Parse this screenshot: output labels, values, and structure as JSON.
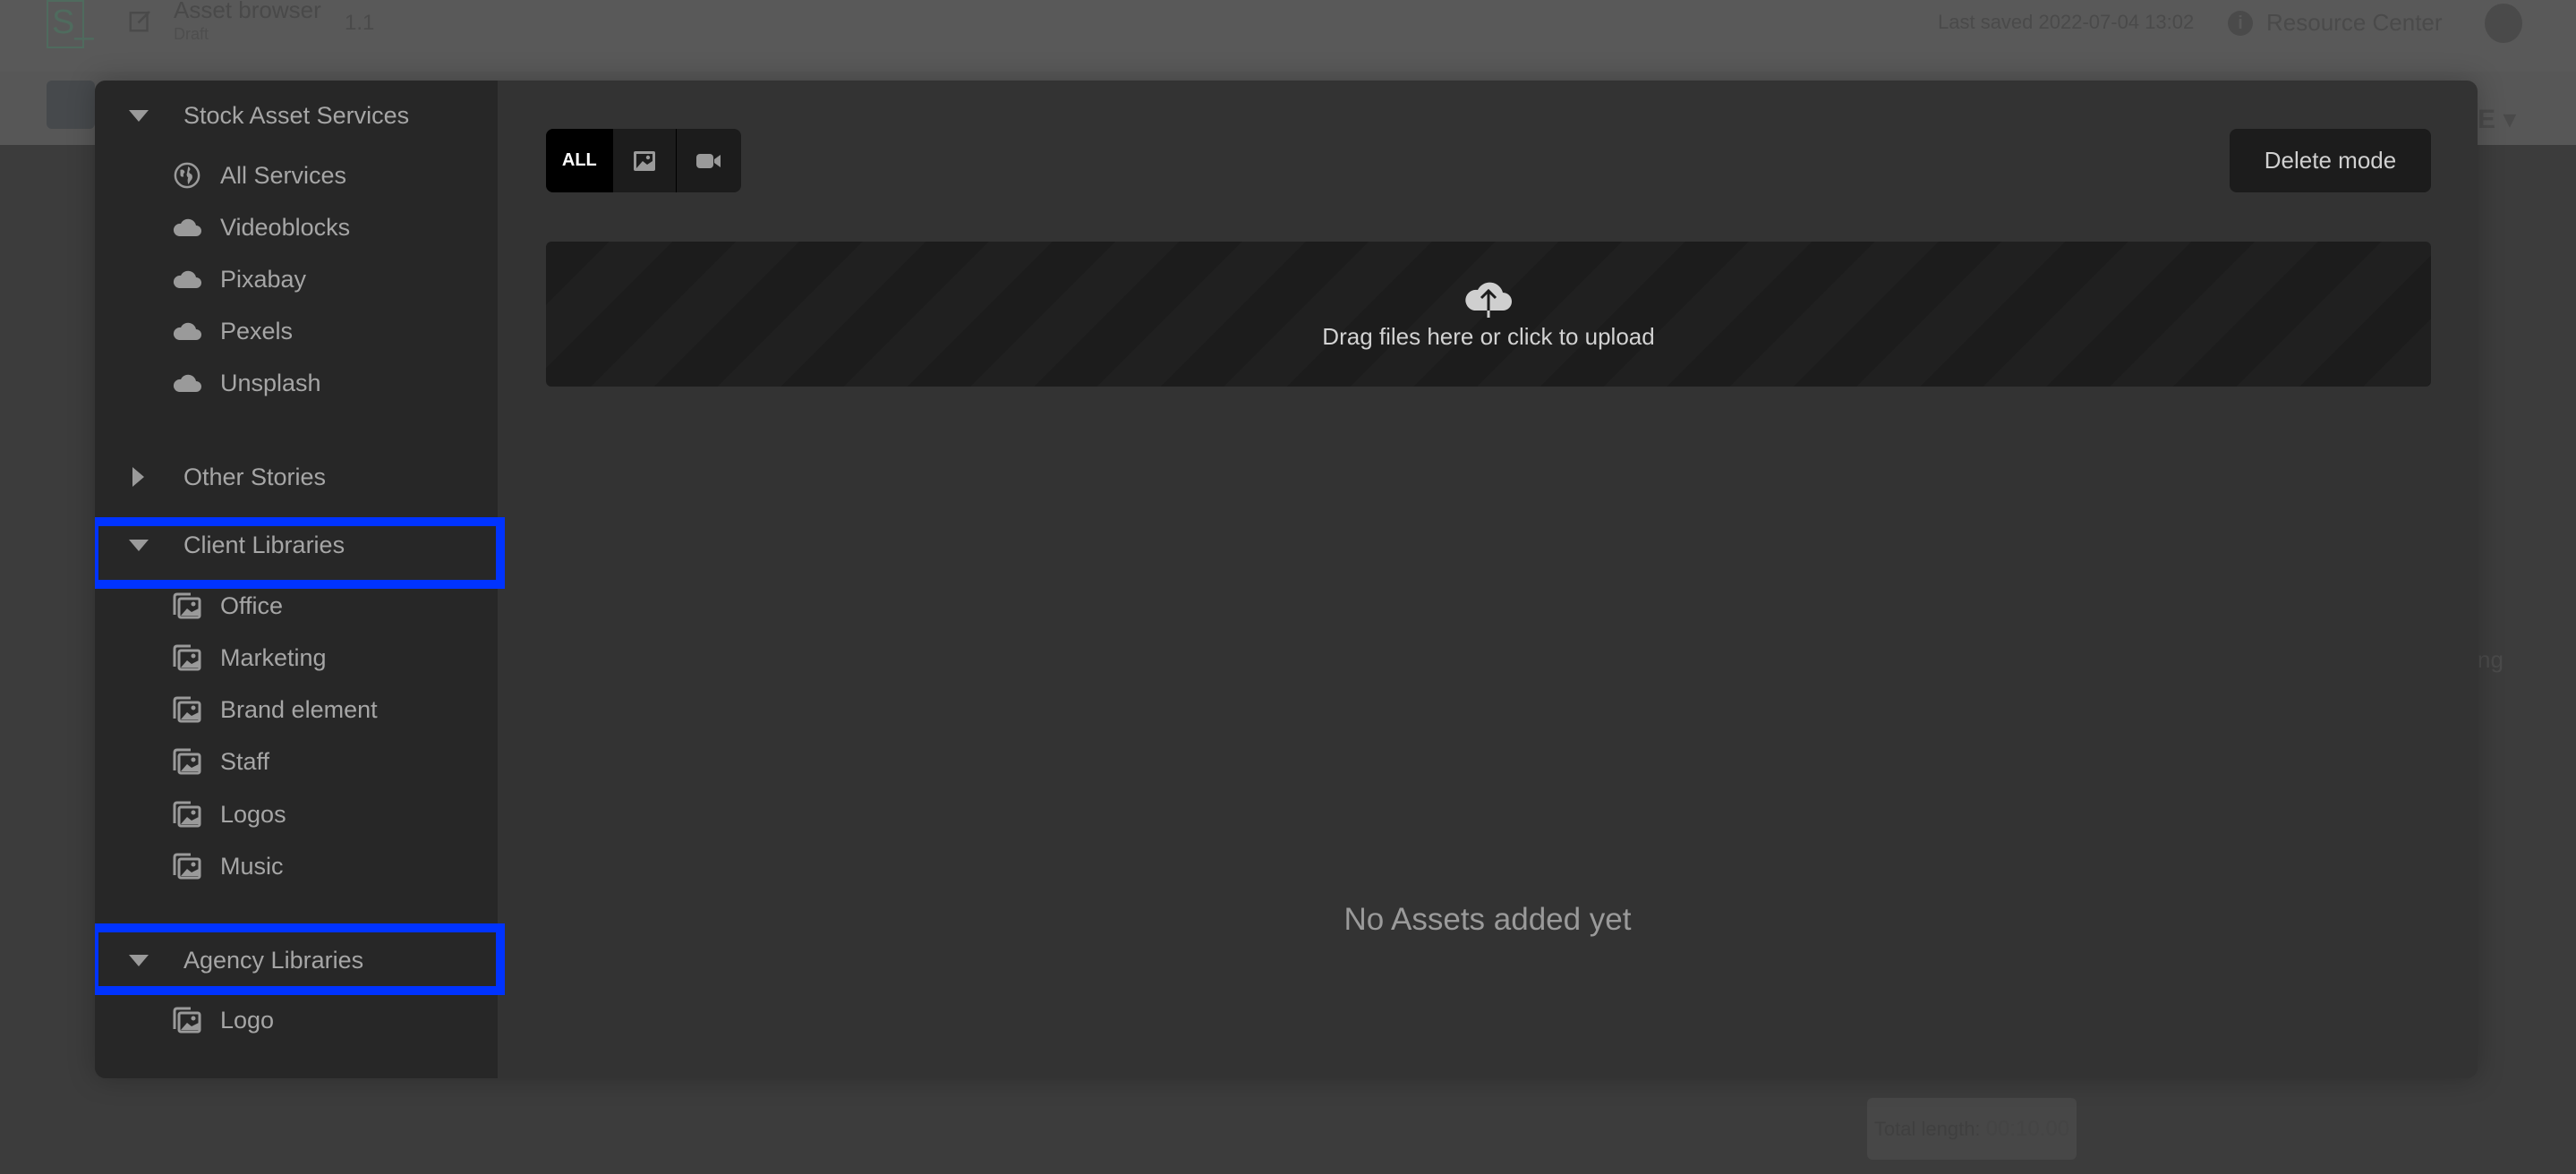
{
  "background_app": {
    "logo_text": "S_",
    "document": {
      "title": "Asset browser",
      "status": "Draft",
      "version": "1.1"
    },
    "last_saved": "Last saved 2022-07-04 13:02",
    "resource_center": "Resource Center",
    "dropdown_glyph": "E ▾",
    "side_text": "ng",
    "total_length_label": "Total length:",
    "total_length_value": "00:10.00"
  },
  "sidebar": {
    "groups": [
      {
        "label": "Stock Asset Services",
        "expanded": true,
        "items": [
          {
            "label": "All Services",
            "icon": "globe-icon"
          },
          {
            "label": "Videoblocks",
            "icon": "cloud-icon"
          },
          {
            "label": "Pixabay",
            "icon": "cloud-icon"
          },
          {
            "label": "Pexels",
            "icon": "cloud-icon"
          },
          {
            "label": "Unsplash",
            "icon": "cloud-icon"
          }
        ]
      },
      {
        "label": "Other Stories",
        "expanded": false,
        "items": []
      },
      {
        "label": "Client Libraries",
        "expanded": true,
        "highlighted": true,
        "items": [
          {
            "label": "Office",
            "icon": "image-library-icon"
          },
          {
            "label": "Marketing",
            "icon": "image-library-icon"
          },
          {
            "label": "Brand element",
            "icon": "image-library-icon"
          },
          {
            "label": "Staff",
            "icon": "image-library-icon"
          },
          {
            "label": "Logos",
            "icon": "image-library-icon"
          },
          {
            "label": "Music",
            "icon": "image-library-icon"
          }
        ]
      },
      {
        "label": "Agency Libraries",
        "expanded": true,
        "highlighted": true,
        "items": [
          {
            "label": "Logo",
            "icon": "image-library-icon"
          }
        ]
      }
    ],
    "highlight_color": "#0033ff"
  },
  "main": {
    "filters": [
      {
        "label": "ALL",
        "icon": null,
        "active": true
      },
      {
        "label": "",
        "icon": "image-icon",
        "active": false
      },
      {
        "label": "",
        "icon": "video-camera-icon",
        "active": false
      }
    ],
    "delete_mode_label": "Delete mode",
    "dropzone_label": "Drag files here or click to upload",
    "empty_message": "No Assets added yet"
  }
}
